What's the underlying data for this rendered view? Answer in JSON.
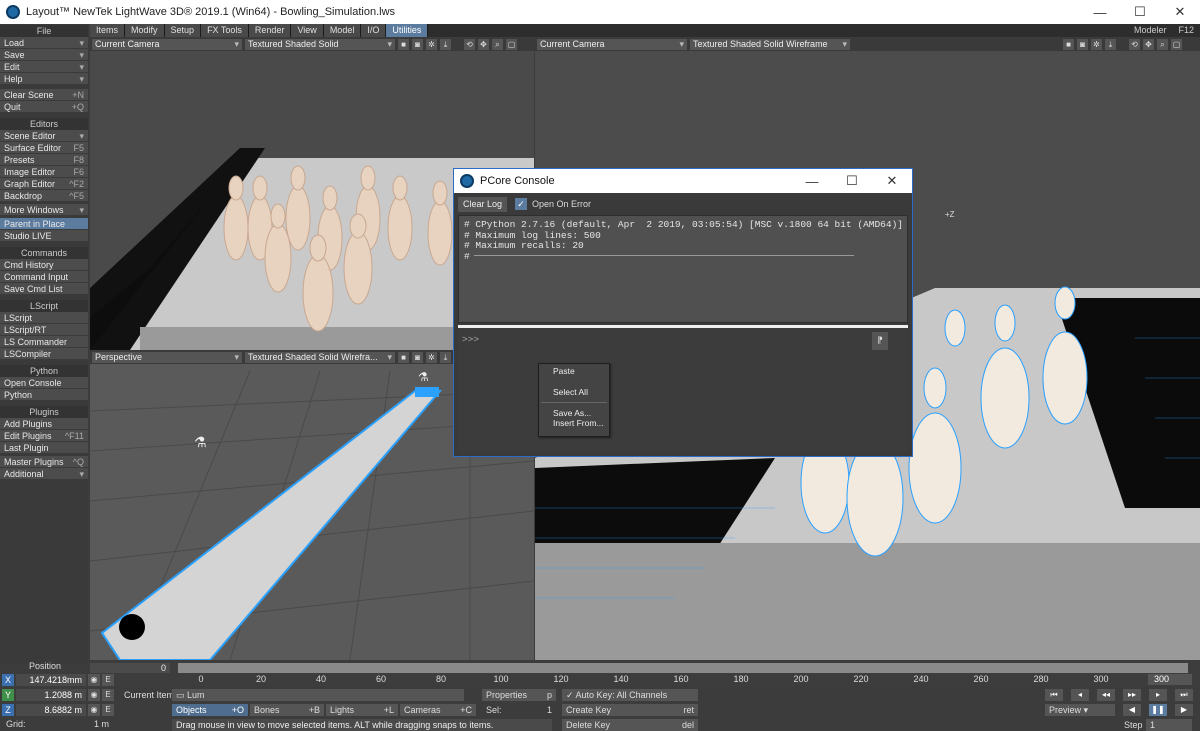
{
  "window": {
    "title": "Layout™ NewTek LightWave 3D® 2019.1 (Win64) - Bowling_Simulation.lws",
    "controls": [
      "—",
      "☐",
      "✕"
    ]
  },
  "tabs": [
    "Items",
    "Modify",
    "Setup",
    "FX Tools",
    "Render",
    "View",
    "Model",
    "I/O",
    "Utilities"
  ],
  "active_tab": "Utilities",
  "modeler": {
    "label": "Modeler",
    "key": "F12"
  },
  "left_panel": {
    "file_header": "File",
    "file_items": [
      {
        "label": "Load",
        "key": "▾"
      },
      {
        "label": "Save",
        "key": "▾"
      },
      {
        "label": "Edit",
        "key": "▾"
      },
      {
        "label": "Help",
        "key": "▾"
      }
    ],
    "clear_scene": {
      "label": "Clear Scene",
      "key": "+N"
    },
    "quit": {
      "label": "Quit",
      "key": "+Q"
    },
    "editors_header": "Editors",
    "editors": [
      {
        "label": "Scene Editor",
        "key": "▾"
      },
      {
        "label": "Surface Editor",
        "key": "F5"
      },
      {
        "label": "Presets",
        "key": "F8"
      },
      {
        "label": "Image Editor",
        "key": "F6"
      },
      {
        "label": "Graph Editor",
        "key": "^F2"
      },
      {
        "label": "Backdrop",
        "key": "^F5"
      },
      {
        "label": "More Windows",
        "key": "▾"
      },
      {
        "label": "Parent in Place",
        "key": ""
      },
      {
        "label": "Studio LIVE",
        "key": ""
      }
    ],
    "commands_header": "Commands",
    "commands": [
      {
        "label": "Cmd History",
        "key": ""
      },
      {
        "label": "Command Input",
        "key": ""
      },
      {
        "label": "Save Cmd List",
        "key": ""
      }
    ],
    "lscript_header": "LScript",
    "lscript": [
      {
        "label": "LScript",
        "key": ""
      },
      {
        "label": "LScript/RT",
        "key": ""
      },
      {
        "label": "LS Commander",
        "key": ""
      },
      {
        "label": "LSCompiler",
        "key": ""
      }
    ],
    "python_header": "Python",
    "python": [
      {
        "label": "Open Console",
        "key": ""
      },
      {
        "label": "Python",
        "key": ""
      }
    ],
    "plugins_header": "Plugins",
    "plugins": [
      {
        "label": "Add Plugins",
        "key": ""
      },
      {
        "label": "Edit Plugins",
        "key": "^F11"
      },
      {
        "label": "Last Plugin",
        "key": ""
      },
      {
        "label": "Master Plugins",
        "key": "^Q"
      },
      {
        "label": "Additional",
        "key": "▾"
      }
    ]
  },
  "viewports": {
    "top_left": {
      "view": "Current Camera",
      "mode": "Textured Shaded Solid"
    },
    "top_right": {
      "view": "Current Camera",
      "mode": "Textured Shaded Solid Wireframe",
      "axis_label": "+Z"
    },
    "bottom_left": {
      "view": "Perspective",
      "mode": "Textured Shaded Solid Wirefra..."
    }
  },
  "console": {
    "title": "PCore Console",
    "clear_log": "Clear Log",
    "open_on_error": "Open On Error",
    "log_lines": [
      "# CPython 2.7.16 (default, Apr  2 2019, 03:05:54) [MSC v.1800 64 bit (AMD64)]",
      "# Maximum log lines: 500",
      "# Maximum recalls: 20",
      "#"
    ],
    "prompt": ">>>"
  },
  "context_menu": [
    "Paste",
    "Select All",
    "Save As...",
    "Insert From..."
  ],
  "timeline": {
    "start": "0",
    "end": "300",
    "ticks": [
      "0",
      "20",
      "40",
      "60",
      "80",
      "100",
      "120",
      "140",
      "160",
      "180",
      "200",
      "220",
      "240",
      "260",
      "280",
      "300"
    ]
  },
  "position": {
    "label": "Position",
    "x": "147.4218mm",
    "y": "1.2088 m",
    "z": "8.6882 m",
    "grid_label": "Grid:",
    "grid_value": "1 m"
  },
  "bottom": {
    "current_item_label": "Current Item",
    "current_item": "Lum",
    "properties": "Properties",
    "properties_key": "p",
    "auto_key": "Auto Key: All Channels",
    "objects": "Objects",
    "objects_key": "+O",
    "bones": "Bones",
    "bones_key": "+B",
    "lights": "Lights",
    "lights_key": "+L",
    "cameras": "Cameras",
    "cameras_key": "+C",
    "sel_label": "Sel:",
    "sel_value": "1",
    "create_key": "Create Key",
    "create_key_k": "ret",
    "delete_key": "Delete Key",
    "delete_key_k": "del",
    "preview": "Preview",
    "step_label": "Step",
    "step_value": "1",
    "status": "Drag mouse in view to move selected items. ALT while dragging snaps to items."
  },
  "colors": {
    "accent": "#5b7c9e",
    "panel": "#3a3a3a",
    "wire": "#2aa0ff"
  }
}
